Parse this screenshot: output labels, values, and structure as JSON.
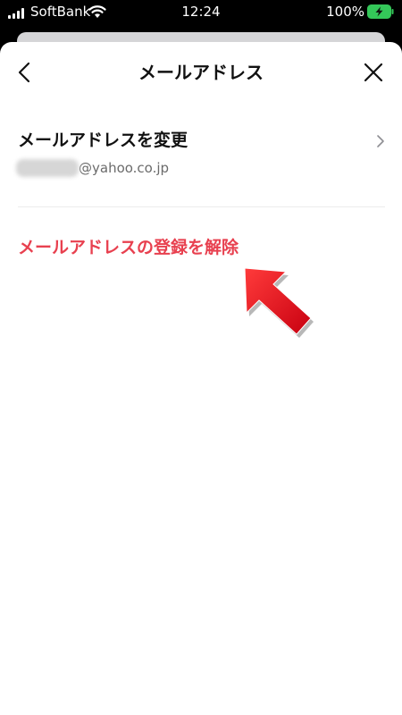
{
  "status_bar": {
    "carrier": "SoftBank",
    "time": "12:24",
    "battery": "100%"
  },
  "header": {
    "title": "メールアドレス"
  },
  "change_row": {
    "label": "メールアドレスを変更",
    "email_domain": "@yahoo.co.jp"
  },
  "delete_link": {
    "label": "メールアドレスの登録を解除"
  },
  "colors": {
    "accent_red": "#e8404f",
    "battery_green": "#34c759",
    "arrow_red": "#e60012"
  },
  "icons": [
    "signal-icon",
    "wifi-icon",
    "battery-icon",
    "back-chevron-icon",
    "close-icon",
    "chevron-right-icon",
    "pointer-arrow-icon"
  ]
}
